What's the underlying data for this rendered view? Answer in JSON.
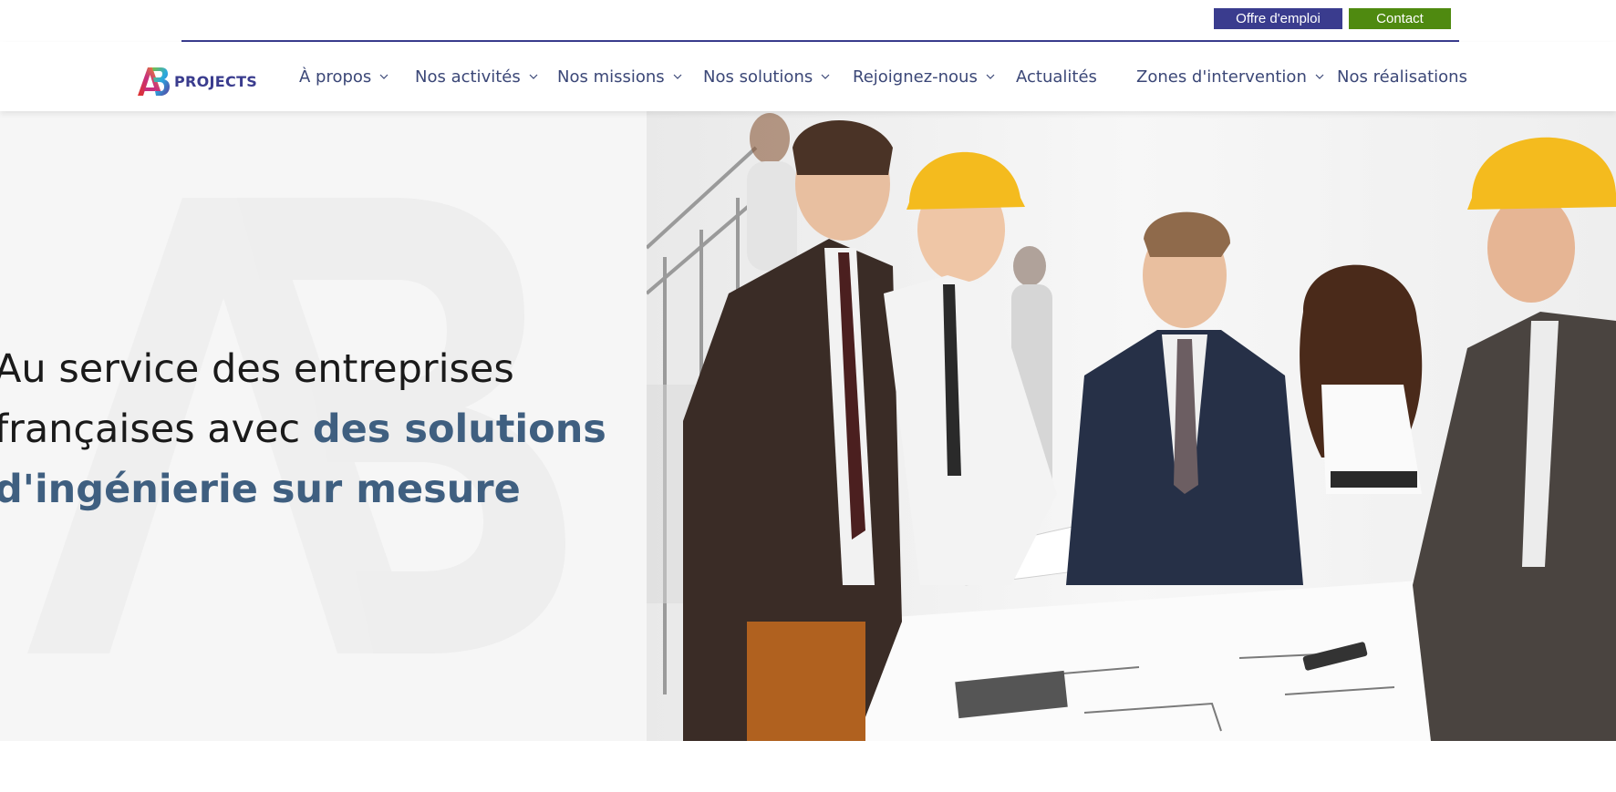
{
  "topbar": {
    "job_button": "Offre d'emploi",
    "contact_button": "Contact",
    "colors": {
      "job_button_bg": "#3a3c8e",
      "contact_button_bg": "#4f8a10",
      "rule": "#3a3c8e"
    }
  },
  "logo": {
    "mark": "AB",
    "text": "PROJECTS"
  },
  "nav": {
    "items": [
      {
        "label": "À propos",
        "has_dropdown": true
      },
      {
        "label": "Nos activités",
        "has_dropdown": true
      },
      {
        "label": "Nos missions",
        "has_dropdown": true
      },
      {
        "label": "Nos solutions",
        "has_dropdown": true
      },
      {
        "label": "Rejoignez-nous",
        "has_dropdown": true
      },
      {
        "label": "Actualités",
        "has_dropdown": false
      },
      {
        "label": "Zones d'intervention",
        "has_dropdown": true
      },
      {
        "label": "Nos réalisations",
        "has_dropdown": false
      }
    ],
    "icons": {
      "dropdown": "chevron-down-icon"
    },
    "color": "#3b4777"
  },
  "hero": {
    "headline_line1": "Au service des entreprises",
    "headline_line2_plain": "françaises avec ",
    "headline_line2_accent": "des solutions",
    "headline_line3_accent": "d'ingénierie sur mesure",
    "accent_color": "#3f5f80",
    "image": "engineers-reviewing-blueprints-photo"
  }
}
